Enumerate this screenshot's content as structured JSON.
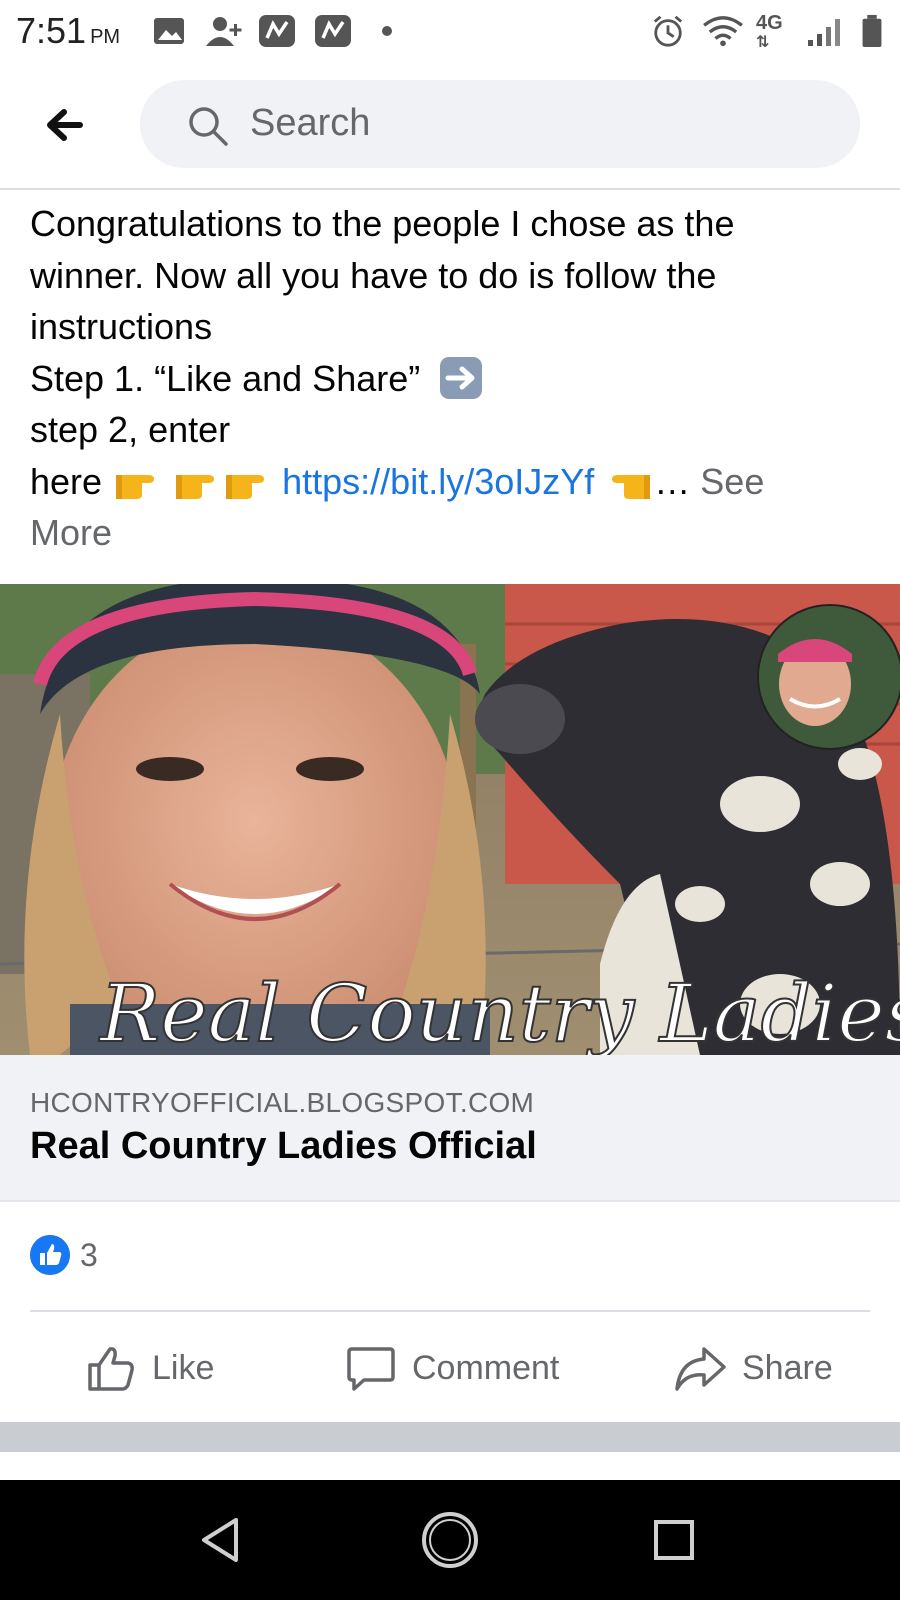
{
  "status_bar": {
    "time": "7:51",
    "ampm": "PM",
    "network": "4G"
  },
  "search": {
    "placeholder": "Search"
  },
  "post": {
    "lines": [
      "Congratulations to the people I chose as the",
      "winner. Now all you have to do is follow the",
      "instructions",
      "Step 1. “Like and Share”",
      "step 2, enter"
    ],
    "here_text": "here",
    "link": "https://bit.ly/3oIJzYf",
    "ellipsis": "…",
    "see_more_1": "See",
    "see_more_2": "More",
    "image_watermark": "Real Country Ladies"
  },
  "link_preview": {
    "domain": "HCONTRYOFFICIAL.BLOGSPOT.COM",
    "title": "Real Country Ladies Official"
  },
  "reactions": {
    "count": "3"
  },
  "actions": {
    "like": "Like",
    "comment": "Comment",
    "share": "Share"
  },
  "colors": {
    "link": "#1b74e4",
    "like_blue": "#1877f2",
    "secondary_text": "#65676b"
  }
}
